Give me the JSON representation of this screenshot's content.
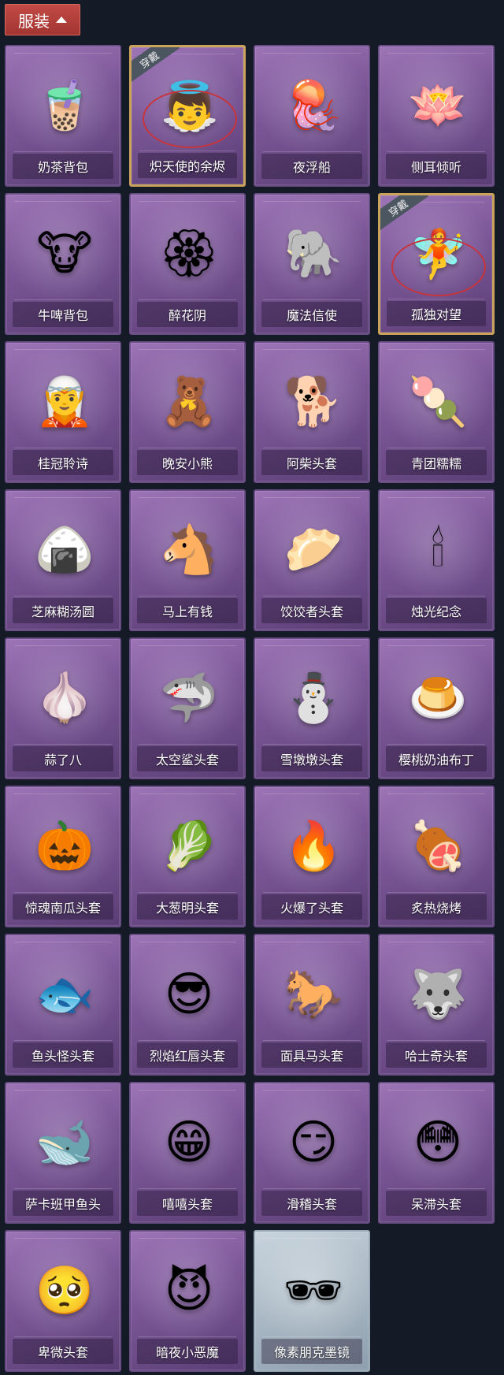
{
  "header": {
    "tab_label": "服装"
  },
  "items": [
    {
      "name": "奶茶背包",
      "equipped": false,
      "icon": "milk-tea-bag-icon",
      "glyph": "🧋"
    },
    {
      "name": "炽天使的余烬",
      "equipped": true,
      "badge": "穿戴",
      "icon": "angel-figure-icon",
      "glyph": "👼"
    },
    {
      "name": "夜浮船",
      "equipped": false,
      "icon": "jellyfish-icon",
      "glyph": "🪼"
    },
    {
      "name": "侧耳倾听",
      "equipped": false,
      "icon": "lotus-wreath-icon",
      "glyph": "🪷"
    },
    {
      "name": "牛啤背包",
      "equipped": false,
      "icon": "cow-beer-barrel-icon",
      "glyph": "🐮"
    },
    {
      "name": "醉花阴",
      "equipped": false,
      "icon": "flower-ornament-icon",
      "glyph": "🏵"
    },
    {
      "name": "魔法信使",
      "equipped": false,
      "icon": "elephant-icon",
      "glyph": "🐘"
    },
    {
      "name": "孤独对望",
      "equipped": true,
      "badge": "穿戴",
      "icon": "figure-keychain-icon",
      "glyph": "🧚"
    },
    {
      "name": "桂冠聆诗",
      "equipped": false,
      "icon": "laurel-figure-keychain-icon",
      "glyph": "🧝"
    },
    {
      "name": "晚安小熊",
      "equipped": false,
      "icon": "bear-keychain-icon",
      "glyph": "🧸"
    },
    {
      "name": "阿柴头套",
      "equipped": false,
      "icon": "shiba-head-icon",
      "glyph": "🐕"
    },
    {
      "name": "青团糯糯",
      "equipped": false,
      "icon": "green-mochi-icon",
      "glyph": "🍡"
    },
    {
      "name": "芝麻糊汤圆",
      "equipped": false,
      "icon": "rice-ball-head-icon",
      "glyph": "🍙"
    },
    {
      "name": "马上有钱",
      "equipped": false,
      "icon": "horse-head-icon",
      "glyph": "🐴"
    },
    {
      "name": "饺饺者头套",
      "equipped": false,
      "icon": "dumpling-head-icon",
      "glyph": "🥟"
    },
    {
      "name": "烛光纪念",
      "equipped": false,
      "icon": "candle-head-icon",
      "glyph": "🕯"
    },
    {
      "name": "蒜了八",
      "equipped": false,
      "icon": "garlic-head-icon",
      "glyph": "🧄"
    },
    {
      "name": "太空鲨头套",
      "equipped": false,
      "icon": "shark-head-icon",
      "glyph": "🦈"
    },
    {
      "name": "雪墩墩头套",
      "equipped": false,
      "icon": "snowman-head-icon",
      "glyph": "⛄"
    },
    {
      "name": "樱桃奶油布丁",
      "equipped": false,
      "icon": "pudding-head-icon",
      "glyph": "🍮"
    },
    {
      "name": "惊魂南瓜头套",
      "equipped": false,
      "icon": "pumpkin-head-icon",
      "glyph": "🎃"
    },
    {
      "name": "大葱明头套",
      "equipped": false,
      "icon": "scallion-head-icon",
      "glyph": "🥬"
    },
    {
      "name": "火爆了头套",
      "equipped": false,
      "icon": "fire-head-icon",
      "glyph": "🔥"
    },
    {
      "name": "炙热烧烤",
      "equipped": false,
      "icon": "bbq-meat-head-icon",
      "glyph": "🍖"
    },
    {
      "name": "鱼头怪头套",
      "equipped": false,
      "icon": "fish-head-icon",
      "glyph": "🐟"
    },
    {
      "name": "烈焰红唇头套",
      "equipped": false,
      "icon": "pikachu-head-icon",
      "glyph": "😎"
    },
    {
      "name": "面具马头套",
      "equipped": false,
      "icon": "horse-mask-icon",
      "glyph": "🐎"
    },
    {
      "name": "哈士奇头套",
      "equipped": false,
      "icon": "husky-head-icon",
      "glyph": "🐺"
    },
    {
      "name": "萨卡班甲鱼头",
      "equipped": false,
      "icon": "sacabambaspis-head-icon",
      "glyph": "🐋"
    },
    {
      "name": "嘻嘻头套",
      "equipped": false,
      "icon": "grin-emoji-head-icon",
      "glyph": "😁"
    },
    {
      "name": "滑稽头套",
      "equipped": false,
      "icon": "smirk-emoji-head-icon",
      "glyph": "😏"
    },
    {
      "name": "呆滞头套",
      "equipped": false,
      "icon": "dazed-emoji-head-icon",
      "glyph": "😳"
    },
    {
      "name": "卑微头套",
      "equipped": false,
      "icon": "pleading-emoji-head-icon",
      "glyph": "🥺"
    },
    {
      "name": "暗夜小恶魔",
      "equipped": false,
      "icon": "little-devil-icon",
      "glyph": "😈"
    },
    {
      "name": "像素朋克墨镜",
      "equipped": false,
      "rarity": "gray",
      "icon": "pixel-sunglasses-icon",
      "glyph": "🕶"
    }
  ]
}
